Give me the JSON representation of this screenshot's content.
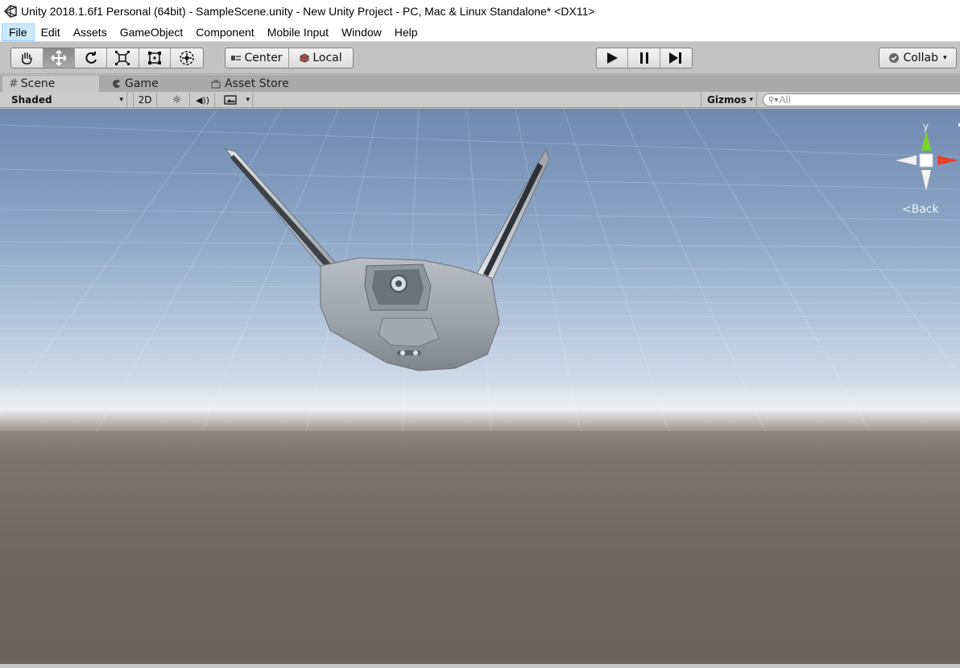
{
  "window": {
    "title": "Unity 2018.1.6f1 Personal (64bit) - SampleScene.unity - New Unity Project - PC, Mac & Linux Standalone* <DX11>"
  },
  "menu": [
    "File",
    "Edit",
    "Assets",
    "GameObject",
    "Component",
    "Mobile Input",
    "Window",
    "Help"
  ],
  "toolbar": {
    "transform_tools": [
      "hand-tool",
      "move-tool",
      "rotate-tool",
      "scale-tool",
      "rect-tool",
      "transform-tool"
    ],
    "pivot_label": "Center",
    "space_label": "Local",
    "play_controls": [
      "play",
      "pause",
      "step"
    ],
    "collab_label": "Collab"
  },
  "tabs": [
    {
      "label": "Scene",
      "icon": "grid-icon",
      "active": true
    },
    {
      "label": "Game",
      "icon": "pacman-icon",
      "active": false
    },
    {
      "label": "Asset Store",
      "icon": "bag-icon",
      "active": false
    }
  ],
  "scene_options": {
    "shading_mode": "Shaded",
    "mode_2d": "2D",
    "gizmos_label": "Gizmos",
    "search_placeholder": "All"
  },
  "gizmo": {
    "axis_y": "y",
    "view_label": "Back"
  },
  "colors": {
    "gizmo_y": "#7ed321",
    "gizmo_x": "#e8402a",
    "menu_highlight": "#cce8ff"
  }
}
